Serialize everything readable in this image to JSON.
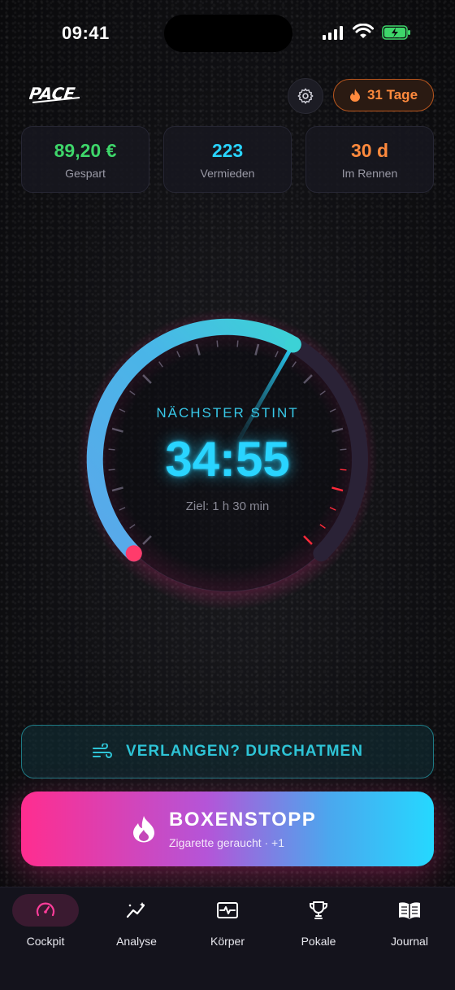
{
  "status": {
    "time": "09:41"
  },
  "header": {
    "logo_text": "PACE",
    "streak_label": "31 Tage"
  },
  "stats": [
    {
      "value": "89,20 €",
      "label": "Gespart",
      "color": "#3ed66a"
    },
    {
      "value": "223",
      "label": "Vermieden",
      "color": "#29d4ff"
    },
    {
      "value": "30 d",
      "label": "Im Rennen",
      "color": "#ff8a3d"
    }
  ],
  "gauge": {
    "label": "NÄCHSTER STINT",
    "time": "34:55",
    "goal": "Ziel: 1 h 30 min",
    "progress": 0.61
  },
  "breathe_button": {
    "label": "VERLANGEN? DURCHATMEN",
    "icon": "wind-icon"
  },
  "pitstop_button": {
    "title": "BOXENSTOPP",
    "subtitle": "Zigarette geraucht  ·  +1",
    "icon": "flame-icon"
  },
  "tabs": [
    {
      "label": "Cockpit",
      "icon": "speedometer-icon",
      "active": true
    },
    {
      "label": "Analyse",
      "icon": "chart-sparkle-icon",
      "active": false
    },
    {
      "label": "Körper",
      "icon": "heart-monitor-icon",
      "active": false
    },
    {
      "label": "Pokale",
      "icon": "trophy-icon",
      "active": false
    },
    {
      "label": "Journal",
      "icon": "book-icon",
      "active": false
    }
  ],
  "colors": {
    "accent_pink": "#ff2d8f",
    "accent_cyan": "#29d4ff",
    "accent_orange": "#ff8a3d",
    "accent_green": "#3ed66a"
  }
}
